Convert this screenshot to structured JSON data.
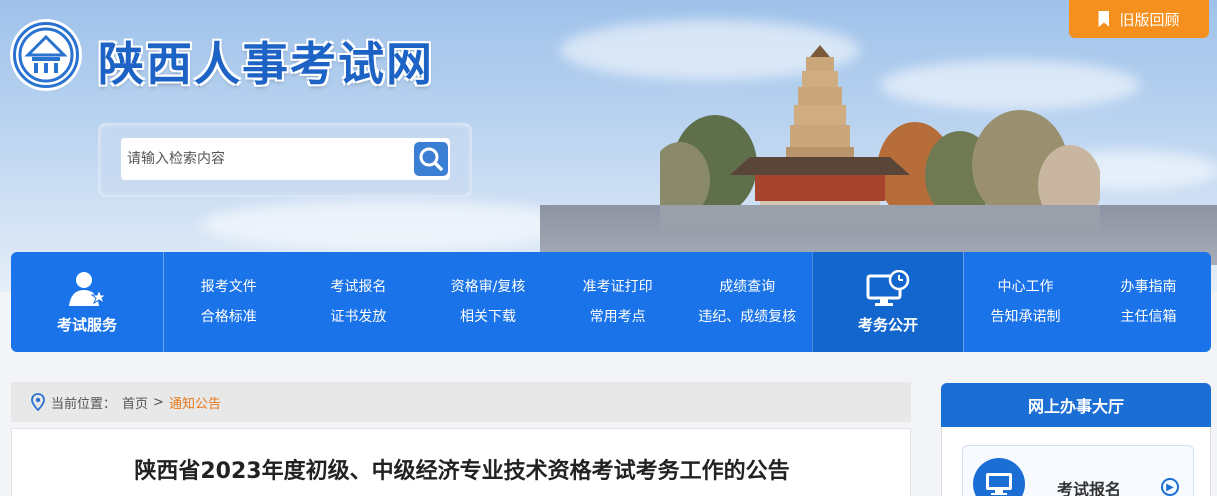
{
  "header": {
    "site_title": "陕西人事考试网",
    "old_version_label": "旧版回顾",
    "search_placeholder": "请输入检索内容"
  },
  "nav": {
    "exam_services": {
      "label": "考试服务",
      "links": [
        "报考文件",
        "考试报名",
        "资格审/复核",
        "准考证打印",
        "成绩查询",
        "合格标准",
        "证书发放",
        "相关下载",
        "常用考点",
        "违纪、成绩复核"
      ]
    },
    "exam_affairs": {
      "label": "考务公开",
      "links": [
        "中心工作",
        "办事指南",
        "告知承诺制",
        "主任信箱"
      ]
    }
  },
  "breadcrumb": {
    "prefix": "当前位置：",
    "home": "首页",
    "separator": ">",
    "current": "通知公告"
  },
  "article": {
    "title": "陕西省2023年度初级、中级经济专业技术资格考试考务工作的公告"
  },
  "sidebar": {
    "title": "网上办事大厅",
    "card_label": "考试报名"
  },
  "colors": {
    "primary_blue": "#1a73e8",
    "accent_orange": "#f5901e",
    "breadcrumb_current": "#e67a1c"
  }
}
